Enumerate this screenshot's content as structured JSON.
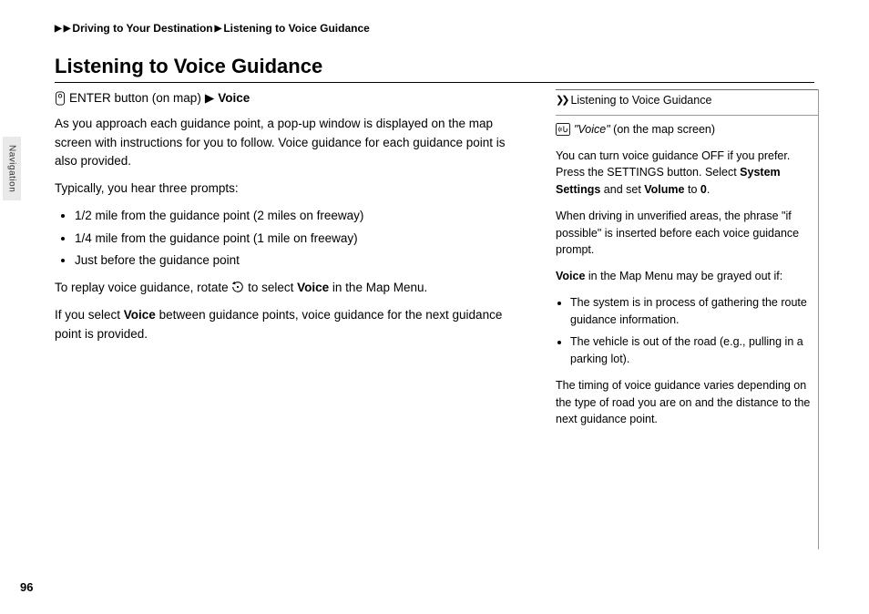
{
  "breadcrumb": {
    "item1": "Driving to Your Destination",
    "item2": "Listening to Voice Guidance"
  },
  "title": "Listening to Voice Guidance",
  "main": {
    "enter_label": "ENTER button (on map)",
    "voice_label": "Voice",
    "para1": "As you approach each guidance point, a pop-up window is displayed on the map screen with instructions for you to follow. Voice guidance for each guidance point is also provided.",
    "para2": "Typically, you hear three prompts:",
    "bullets": [
      "1/2 mile from the guidance point (2 miles on freeway)",
      "1/4 mile from the guidance point (1 mile on freeway)",
      "Just before the guidance point"
    ],
    "para3a": "To replay voice guidance, rotate ",
    "para3b": " to select ",
    "para3_voice": "Voice",
    "para3c": " in the Map Menu.",
    "para4a": "If you select ",
    "para4_voice": "Voice",
    "para4b": " between guidance points, voice guidance for the next guidance point is provided."
  },
  "side": {
    "header": "Listening to Voice Guidance",
    "voice_cmd": "\"Voice\"",
    "voice_cmd_suffix": " (on the map screen)",
    "p1a": "You can turn voice guidance OFF if you prefer. Press the SETTINGS button. Select ",
    "p1_system": "System Settings",
    "p1b": " and set ",
    "p1_volume": "Volume",
    "p1c": " to ",
    "p1_zero": "0",
    "p1d": ".",
    "p2": "When driving in unverified areas, the phrase \"if possible\" is inserted before each voice guidance prompt.",
    "p3a": "",
    "p3_voice": "Voice",
    "p3b": " in the Map Menu may be grayed out if:",
    "bullets": [
      "The system is in process of gathering the route guidance information.",
      "The vehicle is out of the road (e.g., pulling in a parking lot)."
    ],
    "p4": "The timing of voice guidance varies depending on the type of road you are on and the distance to the next guidance point."
  },
  "tab": "Navigation",
  "page_number": "96"
}
